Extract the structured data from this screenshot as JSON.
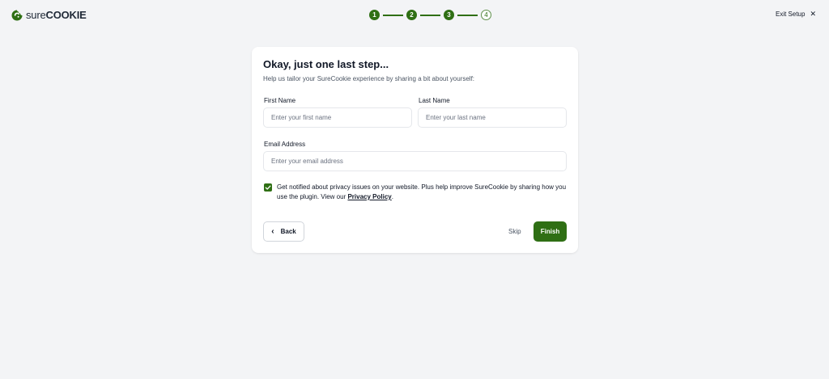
{
  "brand": {
    "name_sure": "sure",
    "name_cookie": "COOKIE",
    "accent_color": "#2f6f14"
  },
  "stepper": {
    "steps": [
      {
        "label": "1",
        "status": "complete"
      },
      {
        "label": "2",
        "status": "complete"
      },
      {
        "label": "3",
        "status": "complete"
      },
      {
        "label": "4",
        "status": "pending"
      }
    ]
  },
  "header": {
    "exit_label": "Exit Setup",
    "exit_icon": "close-icon"
  },
  "form": {
    "title": "Okay, just one last step...",
    "subtitle": "Help us tailor your SureCookie experience by sharing a bit about yourself:",
    "first_name": {
      "label": "First Name",
      "placeholder": "Enter your first name",
      "value": ""
    },
    "last_name": {
      "label": "Last Name",
      "placeholder": "Enter your last name",
      "value": ""
    },
    "email": {
      "label": "Email Address",
      "placeholder": "Enter your email address",
      "value": ""
    },
    "consent": {
      "checked": true,
      "text": "Get notified about privacy issues on your website. Plus help improve SureCookie by sharing how you use the plugin. View our ",
      "link_text": "Privacy Policy",
      "suffix": "."
    },
    "actions": {
      "back_label": "Back",
      "skip_label": "Skip",
      "finish_label": "Finish"
    }
  }
}
